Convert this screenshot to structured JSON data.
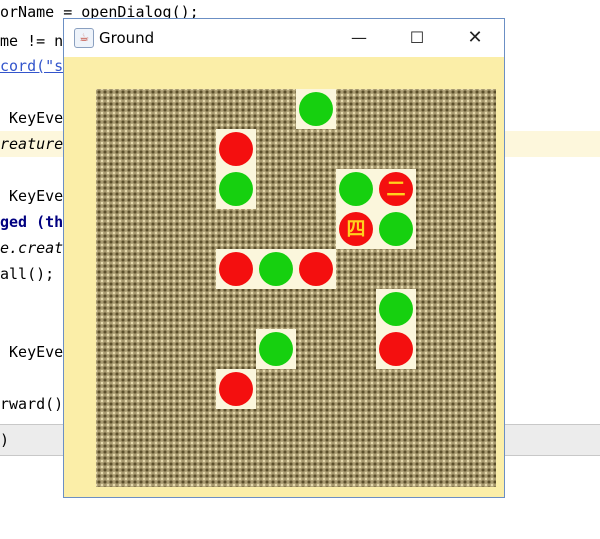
{
  "editor": {
    "lines": [
      {
        "text": "orName = openDialog();"
      },
      {
        "text": "me != nu"
      },
      {
        "text": "cord(\"sr"
      },
      {
        "text": ""
      },
      {
        "text": " KeyEver"
      },
      {
        "text": "reatureW"
      },
      {
        "text": ""
      },
      {
        "text": " KeyEver"
      },
      {
        "text": "ged (thi"
      },
      {
        "text": "e.creat"
      },
      {
        "text": "all();"
      },
      {
        "text": ""
      },
      {
        "text": ""
      },
      {
        "text": " KeyEver"
      },
      {
        "text": ""
      },
      {
        "text": "rward()"
      }
    ],
    "status_text": ")"
  },
  "window": {
    "title": "Ground",
    "icon": "java-cup-icon",
    "controls": {
      "minimize": "—",
      "maximize": "☐",
      "close": "✕"
    }
  },
  "ground": {
    "rows": 10,
    "cols": 10,
    "creatures": [
      {
        "row": 0,
        "col": 5,
        "color": "green",
        "label": ""
      },
      {
        "row": 1,
        "col": 3,
        "color": "red",
        "label": ""
      },
      {
        "row": 2,
        "col": 3,
        "color": "green",
        "label": ""
      },
      {
        "row": 2,
        "col": 6,
        "color": "green",
        "label": ""
      },
      {
        "row": 2,
        "col": 7,
        "color": "red",
        "label": "二"
      },
      {
        "row": 3,
        "col": 6,
        "color": "red",
        "label": "四"
      },
      {
        "row": 3,
        "col": 7,
        "color": "green",
        "label": ""
      },
      {
        "row": 4,
        "col": 3,
        "color": "red",
        "label": ""
      },
      {
        "row": 4,
        "col": 4,
        "color": "green",
        "label": ""
      },
      {
        "row": 4,
        "col": 5,
        "color": "red",
        "label": ""
      },
      {
        "row": 5,
        "col": 7,
        "color": "green",
        "label": ""
      },
      {
        "row": 6,
        "col": 4,
        "color": "green",
        "label": ""
      },
      {
        "row": 6,
        "col": 7,
        "color": "red",
        "label": ""
      },
      {
        "row": 7,
        "col": 3,
        "color": "red",
        "label": ""
      }
    ]
  },
  "colors": {
    "green": "#16d00f",
    "red": "#f40f0f",
    "label": "#ffd21e",
    "window_bg": "#fbeea8"
  }
}
